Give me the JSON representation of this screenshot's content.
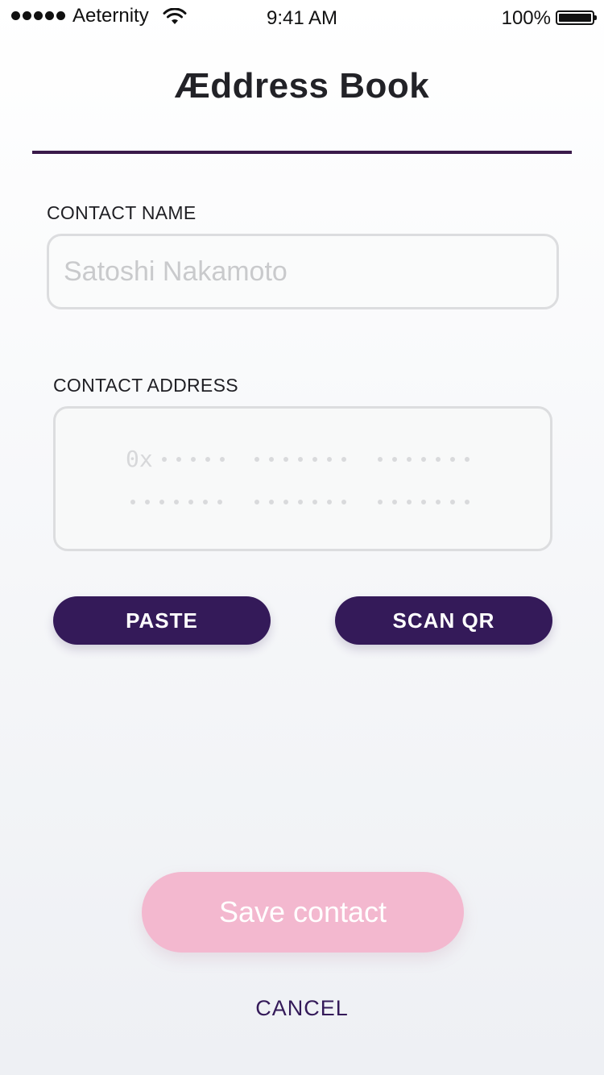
{
  "status_bar": {
    "carrier": "Aeternity",
    "time": "9:41 AM",
    "battery": "100%",
    "battery_level": 1.0,
    "signal_bars": 5,
    "icons": [
      "signal-icon",
      "wifi-icon",
      "battery-icon"
    ]
  },
  "header": {
    "title": "Æddress Book"
  },
  "form": {
    "name_label": "CONTACT NAME",
    "name_placeholder": "Satoshi Nakamoto",
    "name_value": "",
    "address_label": "CONTACT ADDRESS",
    "address_placeholder_prefix": "0x"
  },
  "actions": {
    "paste_label": "PASTE",
    "scan_label": "SCAN QR",
    "save_label": "Save contact",
    "cancel_label": "CANCEL"
  },
  "colors": {
    "primary": "#341a59",
    "save_disabled": "#f3b8cf",
    "divider": "#3a1a4a",
    "field_border": "#dcdddf"
  }
}
